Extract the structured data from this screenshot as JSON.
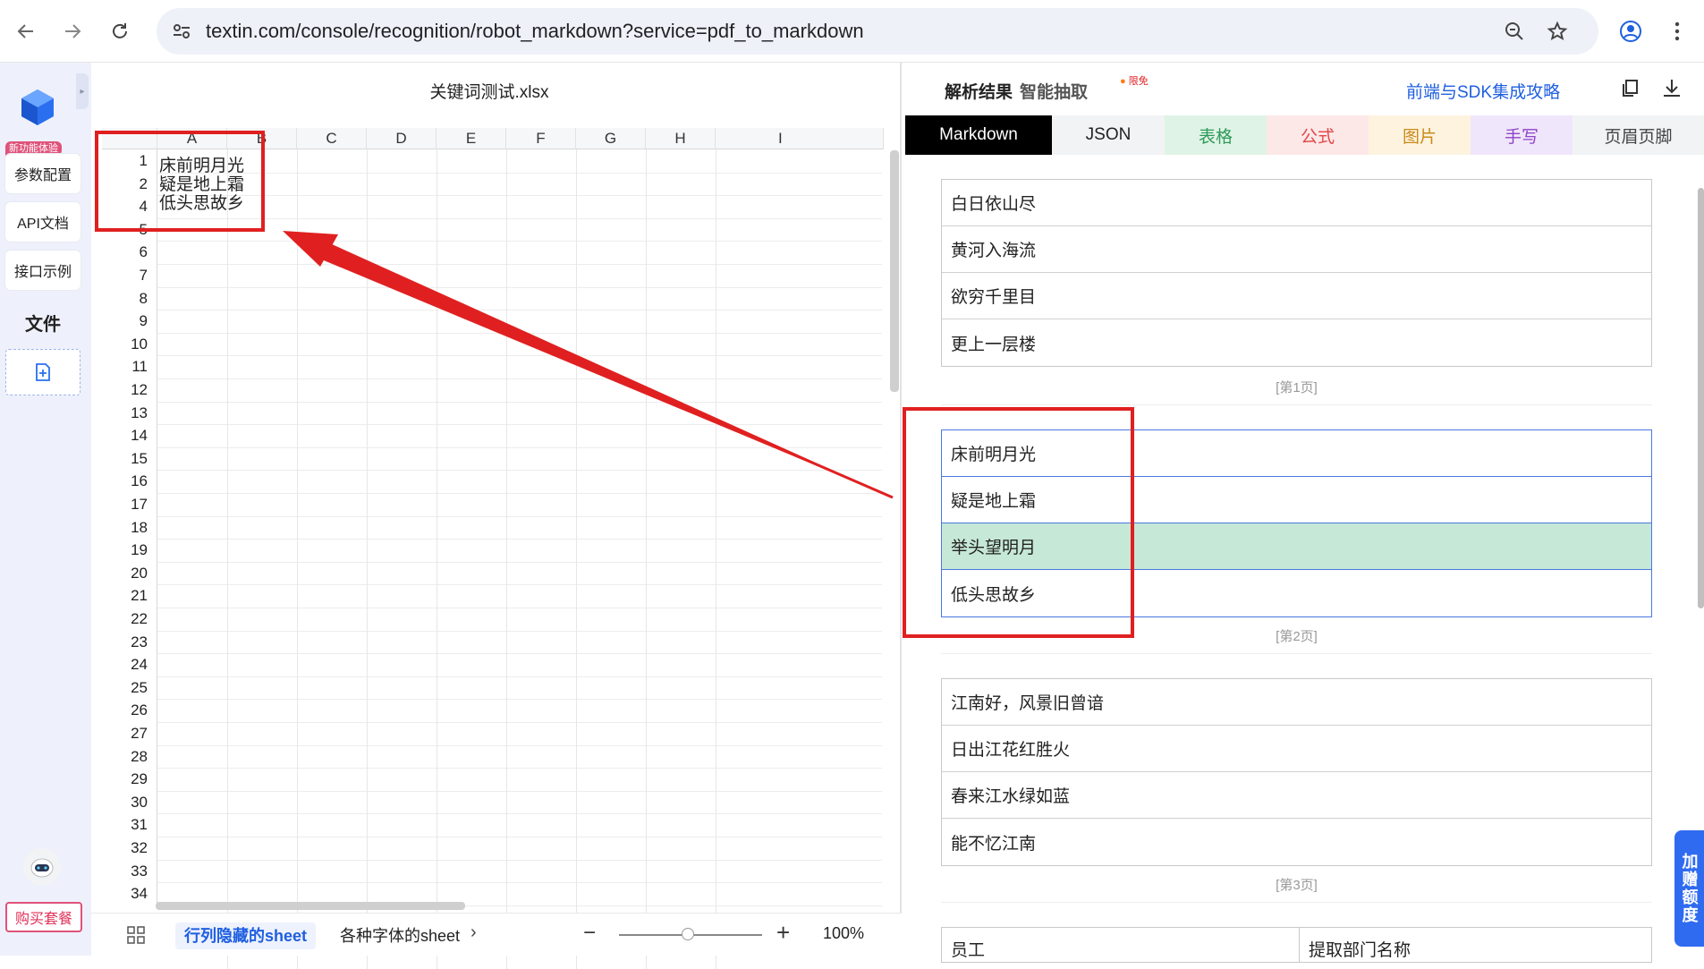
{
  "browser": {
    "url": "textin.com/console/recognition/robot_markdown?service=pdf_to_markdown"
  },
  "sidebar": {
    "new_badge": "新功能体验",
    "items": [
      {
        "label": "参数配置"
      },
      {
        "label": "API文档"
      },
      {
        "label": "接口示例"
      }
    ],
    "files_heading": "文件",
    "buy_label": "购买套餐"
  },
  "sheet": {
    "title": "关键词测试.xlsx",
    "columns": [
      "A",
      "B",
      "C",
      "D",
      "E",
      "F",
      "G",
      "H",
      "I"
    ],
    "row_numbers": [
      "1",
      "2",
      "4",
      "5",
      "6",
      "7",
      "8",
      "9",
      "10",
      "11",
      "12",
      "13",
      "14",
      "15",
      "16",
      "17",
      "18",
      "19",
      "20",
      "21",
      "22",
      "23",
      "24",
      "25",
      "26",
      "27",
      "28",
      "29",
      "30",
      "31",
      "32",
      "33",
      "34"
    ],
    "cells": [
      {
        "row": "1",
        "text": "床前明月光"
      },
      {
        "row": "2",
        "text": "疑是地上霜"
      },
      {
        "row": "4",
        "text": "低头思故乡"
      }
    ],
    "tabs": [
      "行列隐藏的sheet",
      "各种字体的sheet"
    ],
    "zoom": "100%"
  },
  "result": {
    "tab_parse": "解析结果",
    "tab_extract": "智能抽取",
    "hot_badge": "限免",
    "sdk_link": "前端与SDK集成攻略",
    "format_tabs": [
      {
        "label": "Markdown",
        "bg": "#000000",
        "fg": "#ffffff"
      },
      {
        "label": "JSON",
        "bg": "#f2f3f5",
        "fg": "#222222"
      },
      {
        "label": "表格",
        "bg": "#dff3e6",
        "fg": "#2e9a5a"
      },
      {
        "label": "公式",
        "bg": "#fde8e8",
        "fg": "#e04848"
      },
      {
        "label": "图片",
        "bg": "#fdf3df",
        "fg": "#c98a1a"
      },
      {
        "label": "手写",
        "bg": "#f0e6fb",
        "fg": "#8e44c9"
      },
      {
        "label": "页眉页脚",
        "bg": "#f2f3f5",
        "fg": "#444444"
      }
    ],
    "pages": [
      {
        "rows": [
          "白日依山尽",
          "黄河入海流",
          "欲穷千里目",
          "更上一层楼"
        ],
        "label": "[第1页]"
      },
      {
        "rows": [
          "床前明月光",
          "疑是地上霜",
          "举头望明月",
          "低头思故乡"
        ],
        "label": "[第2页]",
        "highlight_row": 2
      },
      {
        "rows": [
          "江南好，风景旧曾谙",
          "日出江花红胜火",
          "春来江水绿如蓝",
          "能不忆江南"
        ],
        "label": "[第3页]"
      }
    ],
    "next_table_headers": [
      "员工",
      "提取部门名称"
    ],
    "bonus_label": "加赠额度"
  }
}
